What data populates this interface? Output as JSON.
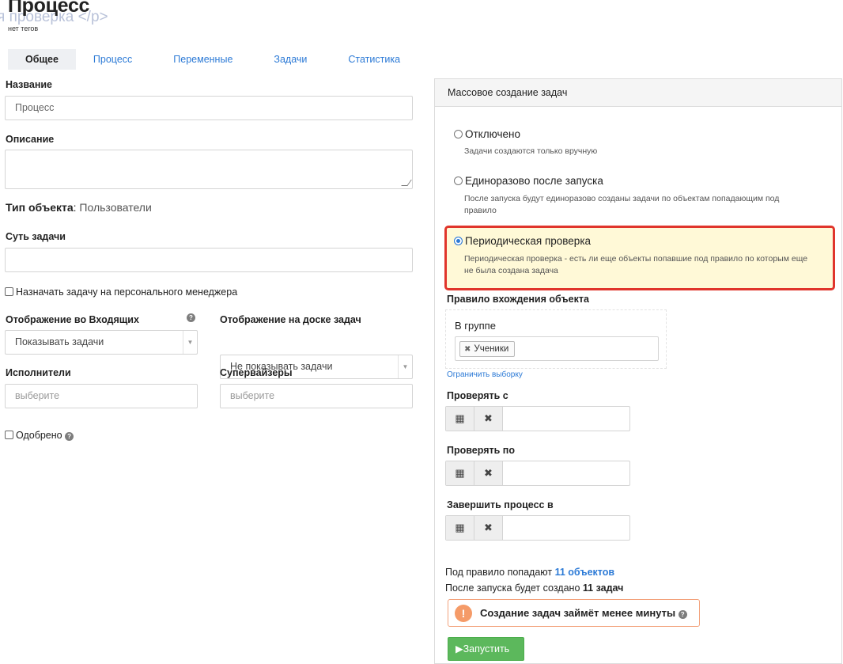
{
  "header": {
    "title": "Процесс",
    "bleed_text": "я проверка </p>",
    "tags_note": "нет тегов"
  },
  "tabs": [
    {
      "label": "Общее",
      "active": true
    },
    {
      "label": "Процесс",
      "active": false
    },
    {
      "label": "Переменные",
      "active": false
    },
    {
      "label": "Задачи",
      "active": false
    },
    {
      "label": "Статистика",
      "active": false
    }
  ],
  "form": {
    "name_label": "Название",
    "name_value": "Процесс",
    "description_label": "Описание",
    "object_type_key": "Тип объекта",
    "object_type_sep": ":",
    "object_type_value": "Пользователи",
    "task_essence_label": "Суть задачи",
    "assign_manager_label": "Назначать задачу на персонального менеджера",
    "inbox_display_label": "Отображение во Входящих",
    "inbox_display_value": "Показывать задачи",
    "board_display_label": "Отображение на доске задач",
    "board_display_value": "Не показывать задачи",
    "executors_label": "Исполнители",
    "executors_placeholder": "выберите",
    "supervisors_label": "Супервайзеры",
    "supervisors_placeholder": "выберите",
    "approved_label": "Одобрено",
    "help_glyph": "?"
  },
  "panel": {
    "title": "Массовое создание задач",
    "options": [
      {
        "title": "Отключено",
        "desc": "Задачи создаются только вручную",
        "selected": false
      },
      {
        "title": "Единоразово после запуска",
        "desc": "После запуска будут единоразово созданы задачи по объектам попадающим под правило",
        "selected": false
      },
      {
        "title": "Периодическая проверка",
        "desc": "Периодическая проверка - есть ли еще объекты попавшие под правило по которым еще не была создана задача",
        "selected": true
      }
    ],
    "rule_label": "Правило вхождения объекта",
    "rule_group_label": "В группе",
    "rule_chip": "Ученики",
    "limit_link": "Ограничить выборку",
    "check_from_label": "Проверять с",
    "check_to_label": "Проверять по",
    "finish_label": "Завершить процесс в",
    "calendar_glyph": "▦",
    "clear_glyph": "✖",
    "summary_line1_prefix": "Под правило попадают",
    "summary_line1_link": "11 объектов",
    "summary_line2_prefix": "После запуска будет создано",
    "summary_line2_value": "11 задач",
    "warning_glyph": "!",
    "warning_text": "Создание задач займёт менее минуты",
    "run_button": "▶Запустить"
  },
  "colors": {
    "accent": "#2c7ad6",
    "highlight_border": "#e0352b",
    "highlight_bg": "#fff9d7",
    "run_button": "#5cb85c",
    "warning": "#f59b68"
  }
}
